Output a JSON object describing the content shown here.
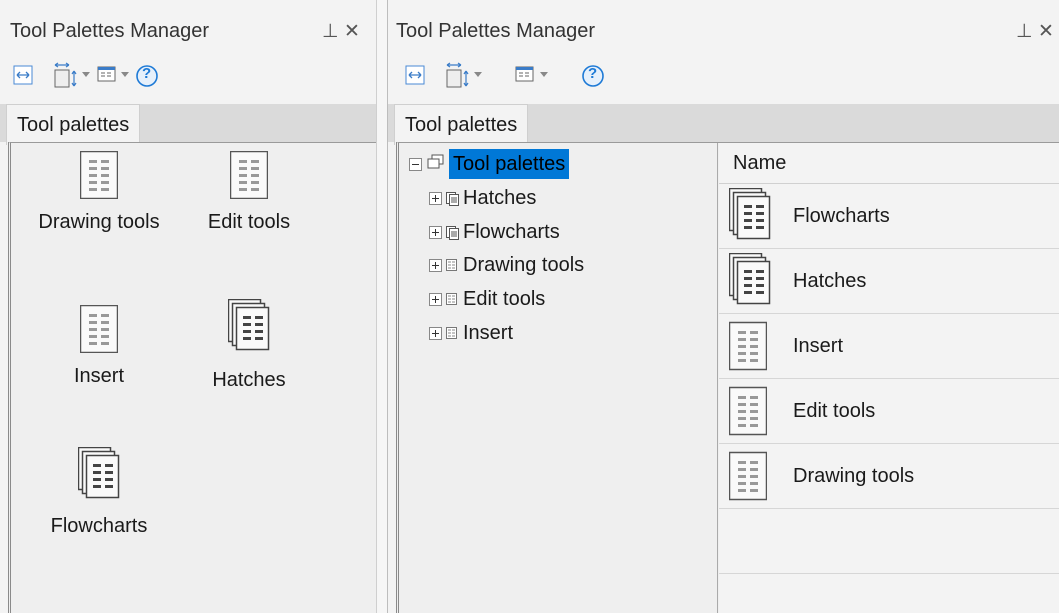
{
  "left_panel": {
    "title": "Tool Palettes Manager",
    "pin_glyph": "⊥",
    "close_glyph": "✕",
    "toolbar": {
      "help_glyph": "?"
    },
    "tab_label": "Tool palettes",
    "tiles": [
      {
        "label": "Drawing tools",
        "icon": "palette-icon"
      },
      {
        "label": "Edit tools",
        "icon": "palette-icon"
      },
      {
        "label": "Insert",
        "icon": "palette-icon"
      },
      {
        "label": "Hatches",
        "icon": "palette-group-icon"
      },
      {
        "label": "Flowcharts",
        "icon": "palette-group-icon"
      }
    ]
  },
  "right_panel": {
    "title": "Tool Palettes Manager",
    "pin_glyph": "⊥",
    "close_glyph": "✕",
    "toolbar": {
      "help_glyph": "?"
    },
    "tab_label": "Tool palettes",
    "tree": {
      "root_label": "Tool palettes",
      "nodes": [
        {
          "label": "Hatches",
          "icon": "palette-group-icon"
        },
        {
          "label": "Flowcharts",
          "icon": "palette-group-icon"
        },
        {
          "label": "Drawing tools",
          "icon": "palette-icon"
        },
        {
          "label": "Edit tools",
          "icon": "palette-icon"
        },
        {
          "label": "Insert",
          "icon": "palette-icon"
        }
      ]
    },
    "list": {
      "column_header": "Name",
      "rows": [
        {
          "label": "Flowcharts",
          "icon": "palette-group-icon"
        },
        {
          "label": "Hatches",
          "icon": "palette-group-icon"
        },
        {
          "label": "Insert",
          "icon": "palette-icon"
        },
        {
          "label": "Edit tools",
          "icon": "palette-icon"
        },
        {
          "label": "Drawing tools",
          "icon": "palette-icon"
        }
      ]
    }
  },
  "colors": {
    "selection": "#0078d7",
    "help_blue": "#1e7ad6"
  }
}
